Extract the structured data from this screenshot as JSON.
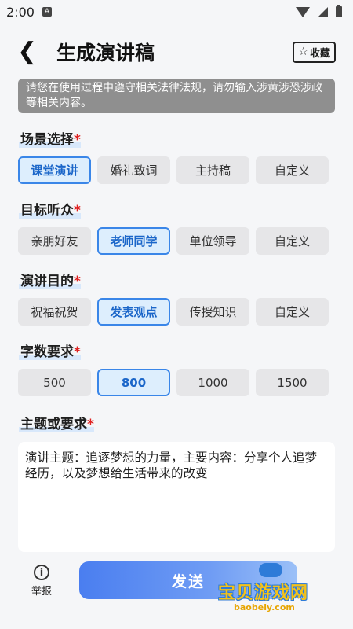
{
  "status_bar": {
    "time": "2:00",
    "a_icon_label": "A"
  },
  "header": {
    "title": "生成演讲稿",
    "fav_label": "收藏"
  },
  "notice": "请您在使用过程中遵守相关法律法规，请勿输入涉黄涉恐涉政等相关内容。",
  "sections": {
    "scene": {
      "title": "场景选择",
      "required_mark": "*",
      "options": [
        "课堂演讲",
        "婚礼致词",
        "主持稿",
        "自定义"
      ],
      "selected_index": 0
    },
    "audience": {
      "title": "目标听众",
      "required_mark": "*",
      "options": [
        "亲朋好友",
        "老师同学",
        "单位领导",
        "自定义"
      ],
      "selected_index": 1
    },
    "purpose": {
      "title": "演讲目的",
      "required_mark": "*",
      "options": [
        "祝福祝贺",
        "发表观点",
        "传授知识",
        "自定义"
      ],
      "selected_index": 1
    },
    "wordcount": {
      "title": "字数要求",
      "required_mark": "*",
      "options": [
        "500",
        "800",
        "1000",
        "1500"
      ],
      "selected_index": 1
    },
    "topic": {
      "title": "主题或要求",
      "required_mark": "*",
      "value": "演讲主题：追逐梦想的力量，主要内容：分享个人追梦经历，以及梦想给生活带来的改变"
    }
  },
  "bottom": {
    "report_label": "举报",
    "send_label": "发送"
  },
  "watermark": {
    "text": "宝贝游戏网",
    "url": "baobeiy.com"
  },
  "colors": {
    "accent": "#3a86e8",
    "required": "#e02020",
    "notice_bg": "#8f8f8f"
  }
}
